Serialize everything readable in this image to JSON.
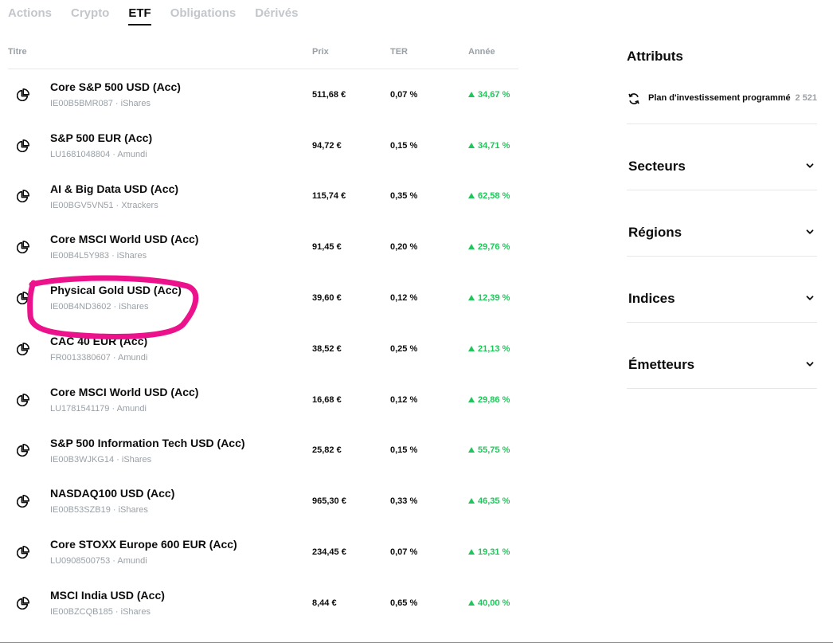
{
  "tabs": [
    {
      "label": "Actions",
      "active": false
    },
    {
      "label": "Crypto",
      "active": false
    },
    {
      "label": "ETF",
      "active": true
    },
    {
      "label": "Obligations",
      "active": false
    },
    {
      "label": "Dérivés",
      "active": false
    }
  ],
  "table": {
    "headers": {
      "title": "Titre",
      "price": "Prix",
      "ter": "TER",
      "year": "Année"
    },
    "rows": [
      {
        "name": "Core S&P 500 USD (Acc)",
        "sub": "IE00B5BMR087 · iShares",
        "price": "511,68 €",
        "ter": "0,07 %",
        "year": "34,67 %"
      },
      {
        "name": "S&P 500 EUR (Acc)",
        "sub": "LU1681048804 · Amundi",
        "price": "94,72 €",
        "ter": "0,15 %",
        "year": "34,71 %"
      },
      {
        "name": "AI & Big Data USD (Acc)",
        "sub": "IE00BGV5VN51 · Xtrackers",
        "price": "115,74 €",
        "ter": "0,35 %",
        "year": "62,58 %"
      },
      {
        "name": "Core MSCI World USD (Acc)",
        "sub": "IE00B4L5Y983 · iShares",
        "price": "91,45 €",
        "ter": "0,20 %",
        "year": "29,76 %"
      },
      {
        "name": "Physical Gold USD (Acc)",
        "sub": "IE00B4ND3602 · iShares",
        "price": "39,60 €",
        "ter": "0,12 %",
        "year": "12,39 %"
      },
      {
        "name": "CAC 40 EUR (Acc)",
        "sub": "FR0013380607 · Amundi",
        "price": "38,52 €",
        "ter": "0,25 %",
        "year": "21,13 %"
      },
      {
        "name": "Core MSCI World USD (Acc)",
        "sub": "LU1781541179 · Amundi",
        "price": "16,68 €",
        "ter": "0,12 %",
        "year": "29,86 %"
      },
      {
        "name": "S&P 500 Information Tech USD (Acc)",
        "sub": "IE00B3WJKG14 · iShares",
        "price": "25,82 €",
        "ter": "0,15 %",
        "year": "55,75 %"
      },
      {
        "name": "NASDAQ100 USD (Acc)",
        "sub": "IE00B53SZB19 · iShares",
        "price": "965,30 €",
        "ter": "0,33 %",
        "year": "46,35 %"
      },
      {
        "name": "Core STOXX Europe 600 EUR (Acc)",
        "sub": "LU0908500753 · Amundi",
        "price": "234,45 €",
        "ter": "0,07 %",
        "year": "19,31 %"
      },
      {
        "name": "MSCI India USD (Acc)",
        "sub": "IE00BZCQB185 · iShares",
        "price": "8,44 €",
        "ter": "0,65 %",
        "year": "40,00 %"
      }
    ]
  },
  "sidebar": {
    "title": "Attributs",
    "attribute": {
      "label": "Plan d'investissement programmé",
      "count": "2 521"
    },
    "filters": [
      {
        "label": "Secteurs"
      },
      {
        "label": "Régions"
      },
      {
        "label": "Indices"
      },
      {
        "label": "Émetteurs"
      }
    ]
  },
  "colors": {
    "accent_text": "#0c0c0c",
    "muted_text": "#9aa0a6",
    "positive": "#1fc75a",
    "annotation": "#ec128c"
  },
  "icons": {
    "row_icon": "pie-chart-icon",
    "attribute_icon": "refresh-icon",
    "filter_icon": "chevron-down-icon"
  }
}
